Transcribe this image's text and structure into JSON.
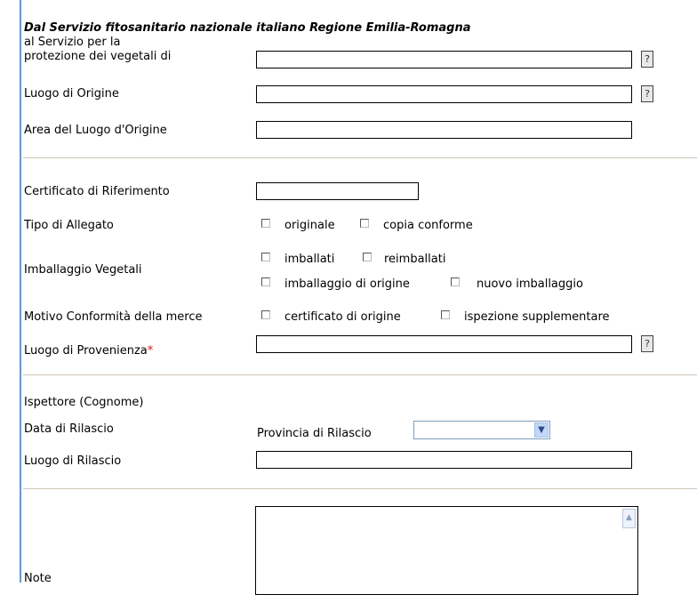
{
  "form": {
    "header_title": "Dal Servizio fitosanitario nazionale italiano Regione Emilia-Romagna",
    "servizio_label_line1": "al Servizio per la",
    "servizio_label_line2": "protezione dei vegetali di",
    "servizio_value": "",
    "help_glyph": "?",
    "luogo_origine_label": "Luogo di Origine",
    "luogo_origine_value": "",
    "area_origine_label": "Area del Luogo d'Origine",
    "area_origine_value": "",
    "certificato_label": "Certificato di Riferimento",
    "certificato_value": "",
    "tipo_allegato_label": "Tipo di Allegato",
    "tipo_allegato_options": [
      "originale",
      "copia conforme"
    ],
    "imballaggio_label": "Imballaggio Vegetali",
    "imballaggio_options_row1": [
      "imballati",
      "reimballati"
    ],
    "imballaggio_options_row2": [
      "imballaggio di origine",
      "nuovo imballaggio"
    ],
    "motivo_label": "Motivo Conformità della merce",
    "motivo_options": [
      "certificato di origine",
      "ispezione supplementare"
    ],
    "provenienza_label": "Luogo di Provenienza",
    "required_mark": "*",
    "provenienza_value": "",
    "ispettore_label": "Ispettore (Cognome)",
    "data_rilascio_label": "Data di Rilascio",
    "provincia_label": "Provincia di Rilascio",
    "provincia_value": "",
    "luogo_rilascio_label": "Luogo di Rilascio",
    "luogo_rilascio_value": "",
    "note_label": "Note",
    "note_value": ""
  },
  "icons": {
    "dropdown": "chevron-down-icon",
    "scroll_up": "scroll-up-icon"
  }
}
